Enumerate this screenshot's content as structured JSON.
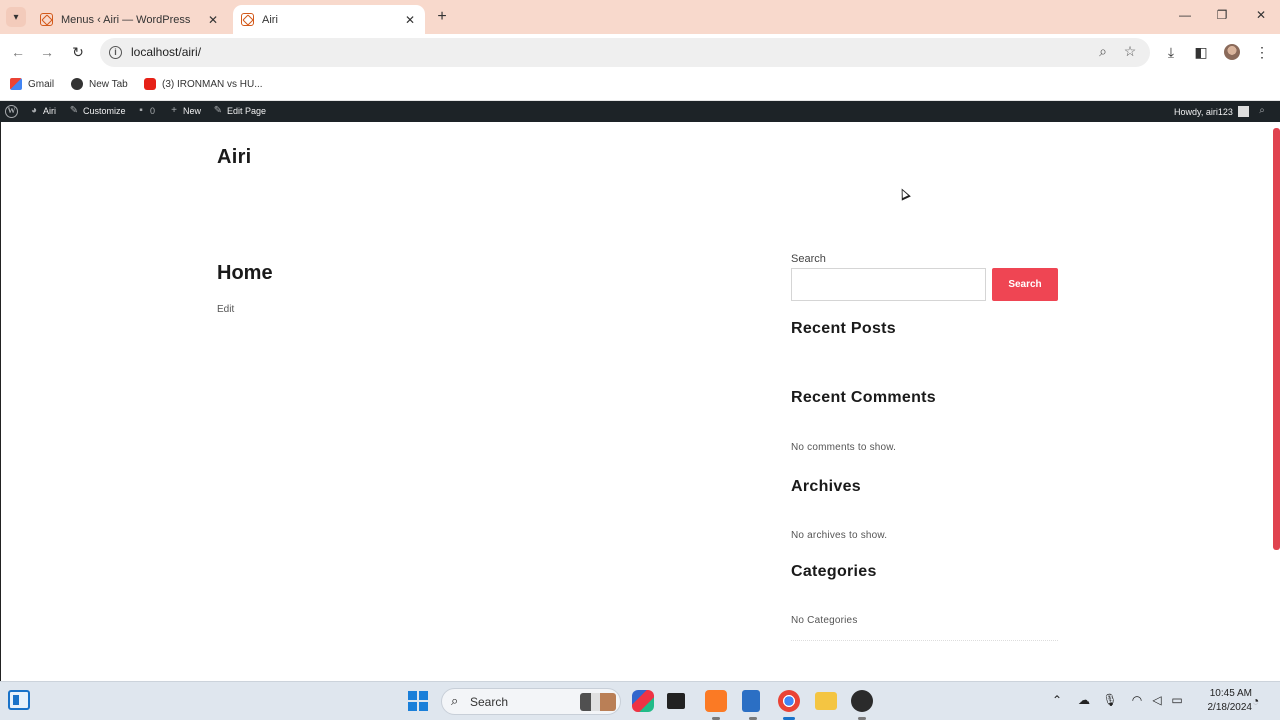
{
  "browser": {
    "tabs": [
      {
        "title": "Menus ‹ Airi — WordPress",
        "active": false
      },
      {
        "title": "Airi",
        "active": true
      }
    ],
    "url": "localhost/airi/",
    "bookmarks": [
      {
        "label": "Gmail",
        "icon": "gmail-icon"
      },
      {
        "label": "New Tab",
        "icon": "globe-icon"
      },
      {
        "label": "(3) IRONMAN vs HU...",
        "icon": "youtube-icon"
      }
    ]
  },
  "adminbar": {
    "site_name": "Airi",
    "customize": "Customize",
    "comments_count": "0",
    "new": "New",
    "edit_page": "Edit Page",
    "howdy": "Howdy, airi123"
  },
  "page": {
    "site_title": "Airi",
    "post_title": "Home",
    "edit_link": "Edit"
  },
  "sidebar": {
    "search_label": "Search",
    "search_button": "Search",
    "search_placeholder": "",
    "recent_posts_title": "Recent Posts",
    "recent_comments_title": "Recent Comments",
    "recent_comments_empty": "No comments to show.",
    "archives_title": "Archives",
    "archives_empty": "No archives to show.",
    "categories_title": "Categories",
    "categories_empty": "No Categories"
  },
  "taskbar": {
    "search_text": "Search",
    "time": "10:45 AM",
    "date": "2/18/2024"
  },
  "colors": {
    "accent": "#ef4553",
    "adminbar": "#1d2327",
    "tabstrip": "#f8d9cc",
    "taskbar": "#dfe6ee"
  }
}
